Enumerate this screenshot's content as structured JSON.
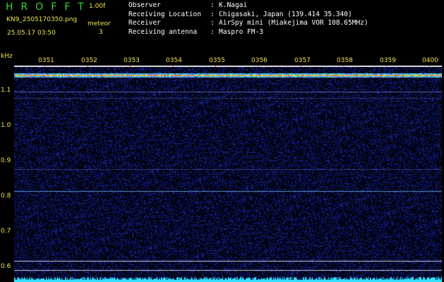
{
  "app": {
    "logo": "HROFFT",
    "version": "1.00f",
    "filename": "KN9_2505170350.png",
    "meteor_label": "meteor",
    "meteor_count": "3",
    "datetime": "25.05.17 03:50"
  },
  "info": {
    "rows": [
      {
        "key": "Observer",
        "value": "K.Nagai"
      },
      {
        "key": "Receiving Location",
        "value": "Chigasaki, Japan (139.414 35.340)"
      },
      {
        "key": "Receiver",
        "value": "AirSpy mini (Miakejima VOR 108.65MHz)"
      },
      {
        "key": "Receiving antenna",
        "value": "Maspro FM-3"
      }
    ],
    "separator": ":"
  },
  "axis": {
    "unit": "kHz",
    "y_ticks": [
      "1.1",
      "1.0",
      "0.9",
      "0.8",
      "0.7",
      "0.6"
    ],
    "x_ticks": [
      "0351",
      "0352",
      "0353",
      "0354",
      "0355",
      "0356",
      "0357",
      "0358",
      "0359",
      "0400"
    ]
  },
  "colors": {
    "background": "#000000",
    "label": "#f0e64a",
    "logo": "#34d634",
    "noise": "#1a2a9a",
    "carrier": "#ff4040",
    "floor": "#33e0ff"
  }
}
